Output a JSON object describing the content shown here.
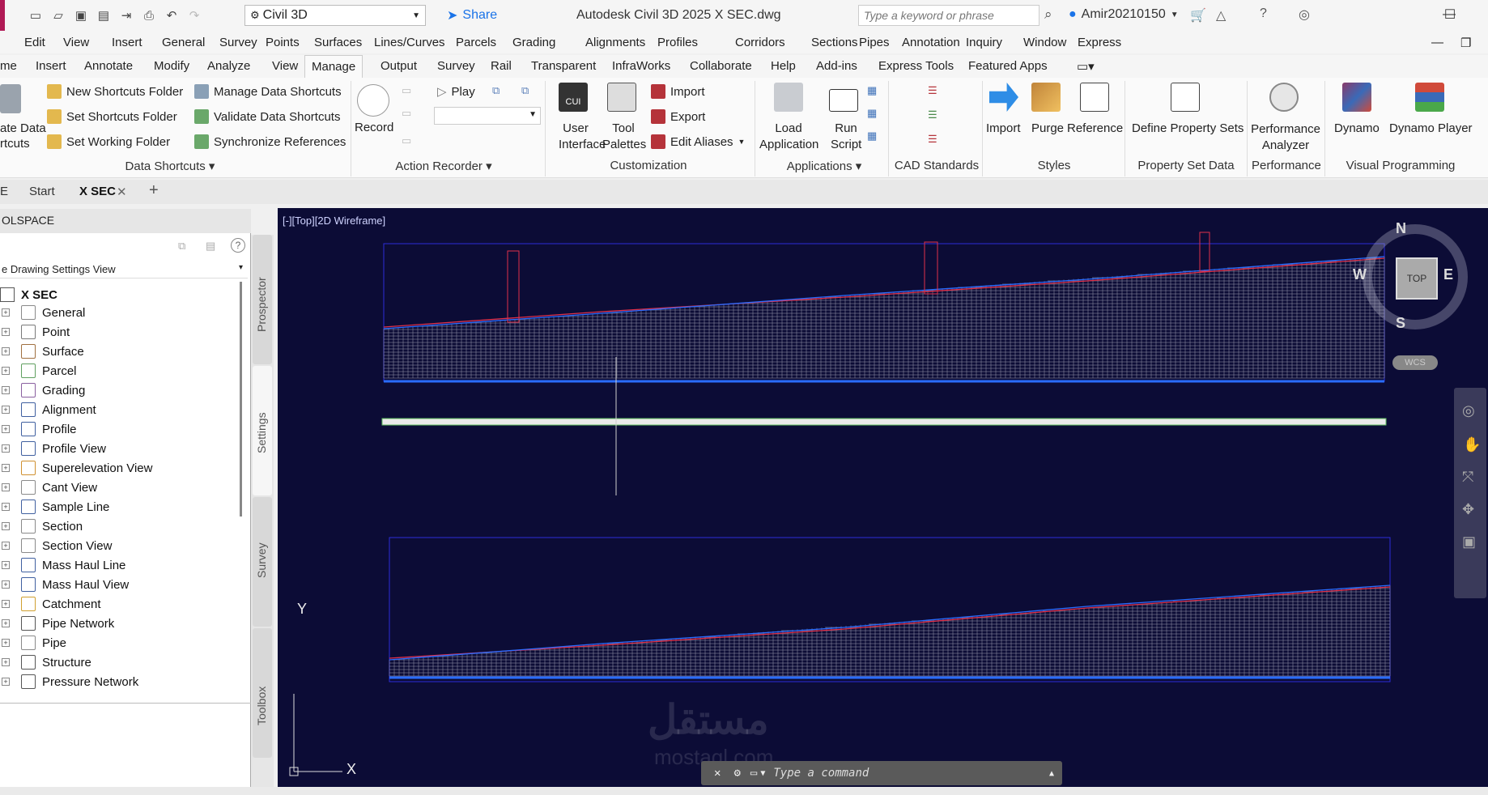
{
  "titlebar": {
    "workspace": "Civil 3D",
    "share": "Share",
    "title": "Autodesk Civil 3D 2025    X SEC.dwg",
    "search_placeholder": "Type a keyword or phrase",
    "user": "Amir20210150"
  },
  "menu": [
    "Edit",
    "View",
    "Insert",
    "General",
    "Survey",
    "Points",
    "Surfaces",
    "Lines/Curves",
    "Parcels",
    "Grading",
    "Alignments",
    "Profiles",
    "Corridors",
    "Sections",
    "Pipes",
    "Annotation",
    "Inquiry",
    "Window",
    "Express"
  ],
  "ribbon_tabs": [
    "me",
    "Insert",
    "Annotate",
    "Modify",
    "Analyze",
    "View",
    "Manage",
    "Output",
    "Survey",
    "Rail",
    "Transparent",
    "InfraWorks",
    "Collaborate",
    "Help",
    "Add-ins",
    "Express Tools",
    "Featured Apps"
  ],
  "active_ribbon_tab": "Manage",
  "ribbon": {
    "data_shortcuts": {
      "create_line1": "ate Data",
      "create_line2": "rtcuts",
      "new_folder": "New Shortcuts Folder",
      "set_folder": "Set Shortcuts Folder",
      "set_working": "Set Working Folder",
      "manage": "Manage Data Shortcuts",
      "validate": "Validate Data Shortcuts",
      "synchronize": "Synchronize References",
      "title": "Data Shortcuts"
    },
    "action_recorder": {
      "record": "Record",
      "play": "Play",
      "title": "Action Recorder"
    },
    "customization": {
      "cui_badge": "CUI",
      "user_interface": "User Interface",
      "tool_palettes": "Tool Palettes",
      "import": "Import",
      "export": "Export",
      "edit_aliases": "Edit Aliases",
      "title": "Customization"
    },
    "applications": {
      "load": "Load Application",
      "run": "Run Script",
      "title": "Applications"
    },
    "cad_standards": {
      "title": "CAD Standards"
    },
    "styles": {
      "import": "Import",
      "purge": "Purge",
      "reference": "Reference",
      "title": "Styles"
    },
    "property_set": {
      "define": "Define Property Sets",
      "title": "Property Set Data"
    },
    "performance": {
      "analyzer": "Performance Analyzer",
      "title": "Performance"
    },
    "visual_programming": {
      "dynamo": "Dynamo",
      "player": "Dynamo Player",
      "title": "Visual Programming"
    }
  },
  "file_tabs": {
    "menu": "E",
    "start": "Start",
    "active": "X SEC"
  },
  "toolspace": {
    "title": "OLSPACE",
    "view": "e Drawing Settings View",
    "root": "X SEC",
    "items": [
      "General",
      "Point",
      "Surface",
      "Parcel",
      "Grading",
      "Alignment",
      "Profile",
      "Profile View",
      "Superelevation View",
      "Cant View",
      "Sample Line",
      "Section",
      "Section View",
      "Mass Haul Line",
      "Mass Haul View",
      "Catchment",
      "Pipe Network",
      "Pipe",
      "Structure",
      "Pressure Network"
    ],
    "vertical_tabs": [
      "Prospector",
      "Settings",
      "Survey",
      "Toolbox"
    ]
  },
  "viewport": {
    "label": "[-][Top][2D Wireframe]",
    "compass": {
      "n": "N",
      "s": "S",
      "e": "E",
      "w": "W",
      "top": "TOP",
      "wcs": "WCS"
    },
    "ucs_x": "X",
    "ucs_y": "Y",
    "command_placeholder": "Type a command",
    "watermark": "مستقل",
    "watermark_sub": "mostaql.com"
  },
  "colors": {
    "viewport_bg": "#0c0c36",
    "accent": "#1a73e8",
    "profile_red": "#e0304a",
    "profile_blue": "#2a6cff"
  }
}
